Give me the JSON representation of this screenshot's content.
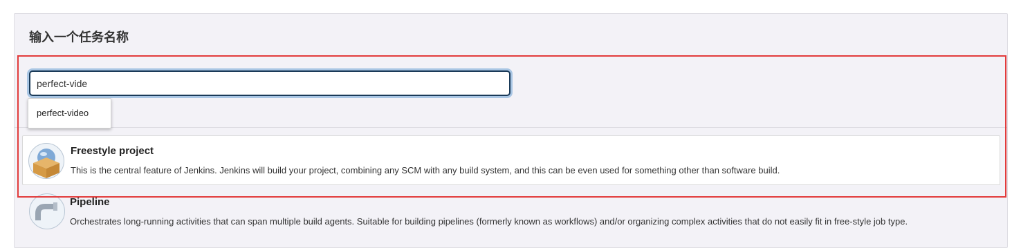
{
  "form": {
    "title": "输入一个任务名称",
    "name_value": "perfect-vide",
    "suggestions": [
      "perfect-video"
    ]
  },
  "job_types": [
    {
      "name": "Freestyle project",
      "description": "This is the central feature of Jenkins. Jenkins will build your project, combining any SCM with any build system, and this can be even used for something other than software build.",
      "icon": "freestyle-project-icon"
    },
    {
      "name": "Pipeline",
      "description": "Orchestrates long-running activities that can span multiple build agents. Suitable for building pipelines (formerly known as workflows) and/or organizing complex activities that do not easily fit in free-style job type.",
      "icon": "pipeline-icon"
    }
  ],
  "colors": {
    "highlight": "#e23b3b",
    "input_border": "#1a3a58",
    "input_focus_ring": "#a9c6e4",
    "panel_bg": "#f3f2f7"
  }
}
